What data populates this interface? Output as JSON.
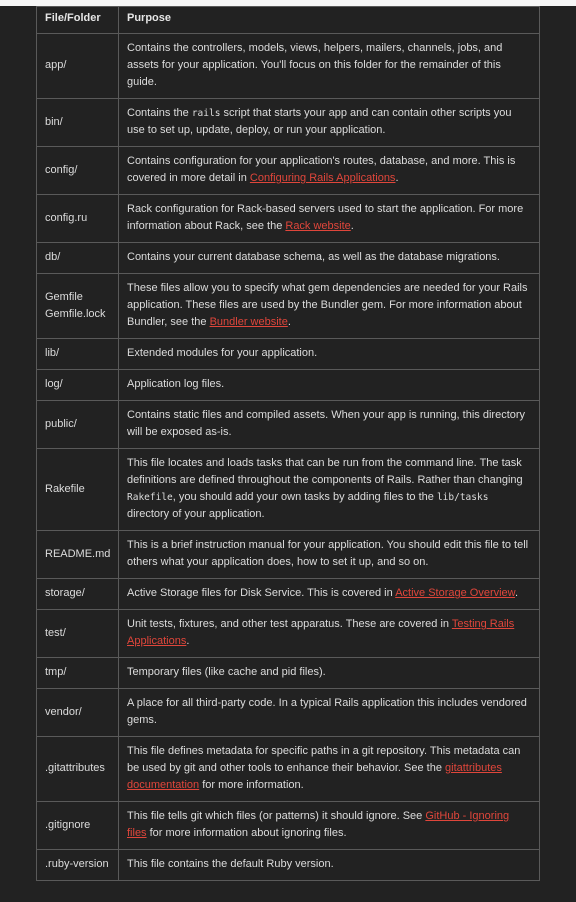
{
  "table": {
    "headers": [
      "File/Folder",
      "Purpose"
    ],
    "rows": [
      {
        "file": "app/",
        "parts": [
          {
            "t": "Contains the controllers, models, views, helpers, mailers, channels, jobs, and assets for your application. You'll focus on this folder for the remainder of this guide."
          }
        ]
      },
      {
        "file": "bin/",
        "parts": [
          {
            "t": "Contains the "
          },
          {
            "t": "rails",
            "code": true
          },
          {
            "t": " script that starts your app and can contain other scripts you use to set up, update, deploy, or run your application."
          }
        ]
      },
      {
        "file": "config/",
        "parts": [
          {
            "t": "Contains configuration for your application's routes, database, and more. This is covered in more detail in "
          },
          {
            "t": "Configuring Rails Applications",
            "link": true
          },
          {
            "t": "."
          }
        ]
      },
      {
        "file": "config.ru",
        "parts": [
          {
            "t": "Rack configuration for Rack-based servers used to start the application. For more information about Rack, see the "
          },
          {
            "t": "Rack website",
            "link": true
          },
          {
            "t": "."
          }
        ]
      },
      {
        "file": "db/",
        "parts": [
          {
            "t": "Contains your current database schema, as well as the database migrations."
          }
        ]
      },
      {
        "file": "Gemfile\nGemfile.lock",
        "parts": [
          {
            "t": "These files allow you to specify what gem dependencies are needed for your Rails application. These files are used by the Bundler gem. For more information about Bundler, see the "
          },
          {
            "t": "Bundler website",
            "link": true
          },
          {
            "t": "."
          }
        ]
      },
      {
        "file": "lib/",
        "parts": [
          {
            "t": "Extended modules for your application."
          }
        ]
      },
      {
        "file": "log/",
        "parts": [
          {
            "t": "Application log files."
          }
        ]
      },
      {
        "file": "public/",
        "parts": [
          {
            "t": "Contains static files and compiled assets. When your app is running, this directory will be exposed as-is."
          }
        ]
      },
      {
        "file": "Rakefile",
        "parts": [
          {
            "t": "This file locates and loads tasks that can be run from the command line. The task definitions are defined throughout the components of Rails. Rather than changing "
          },
          {
            "t": "Rakefile",
            "code": true
          },
          {
            "t": ", you should add your own tasks by adding files to the "
          },
          {
            "t": "lib/tasks",
            "code": true
          },
          {
            "t": " directory of your application."
          }
        ]
      },
      {
        "file": "README.md",
        "parts": [
          {
            "t": "This is a brief instruction manual for your application. You should edit this file to tell others what your application does, how to set it up, and so on."
          }
        ]
      },
      {
        "file": "storage/",
        "parts": [
          {
            "t": "Active Storage files for Disk Service. This is covered in "
          },
          {
            "t": "Active Storage Overview",
            "link": true
          },
          {
            "t": "."
          }
        ]
      },
      {
        "file": "test/",
        "parts": [
          {
            "t": "Unit tests, fixtures, and other test apparatus. These are covered in "
          },
          {
            "t": "Testing Rails Applications",
            "link": true
          },
          {
            "t": "."
          }
        ]
      },
      {
        "file": "tmp/",
        "parts": [
          {
            "t": "Temporary files (like cache and pid files)."
          }
        ]
      },
      {
        "file": "vendor/",
        "parts": [
          {
            "t": "A place for all third-party code. In a typical Rails application this includes vendored gems."
          }
        ]
      },
      {
        "file": ".gitattributes",
        "parts": [
          {
            "t": "This file defines metadata for specific paths in a git repository. This metadata can be used by git and other tools to enhance their behavior. See the "
          },
          {
            "t": "gitattributes documentation",
            "link": true
          },
          {
            "t": " for more information."
          }
        ]
      },
      {
        "file": ".gitignore",
        "parts": [
          {
            "t": "This file tells git which files (or patterns) it should ignore. See "
          },
          {
            "t": "GitHub - Ignoring files",
            "link": true
          },
          {
            "t": " for more information about ignoring files."
          }
        ]
      },
      {
        "file": ".ruby-version",
        "parts": [
          {
            "t": "This file contains the default Ruby version."
          }
        ]
      }
    ]
  },
  "colors": {
    "background": "#222222",
    "text": "#dcdcdc",
    "link": "#e0463b",
    "border": "#5a5a5a"
  }
}
